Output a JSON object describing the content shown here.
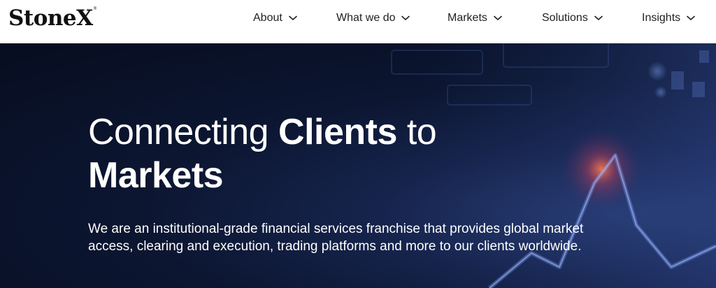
{
  "brand": {
    "name": "StoneX",
    "mark": "®"
  },
  "nav": {
    "items": [
      {
        "label": "About",
        "icon": "chevron-down-icon"
      },
      {
        "label": "What we do",
        "icon": "chevron-down-icon"
      },
      {
        "label": "Markets",
        "icon": "chevron-down-icon"
      },
      {
        "label": "Solutions",
        "icon": "chevron-down-icon"
      },
      {
        "label": "Insights",
        "icon": "chevron-down-icon"
      }
    ]
  },
  "hero": {
    "title_part1": "Connecting ",
    "title_bold1": "Clients",
    "title_part2": " to",
    "title_bold2": "Markets",
    "description": "We are an institutional-grade financial services franchise that provides global market access, clearing and execution, trading platforms and more to our clients worldwide."
  },
  "colors": {
    "header_bg": "#ffffff",
    "nav_text": "#222222",
    "hero_bg": "#0c1631",
    "hero_text": "#ffffff",
    "accent_glow": "#ff6a3d"
  }
}
